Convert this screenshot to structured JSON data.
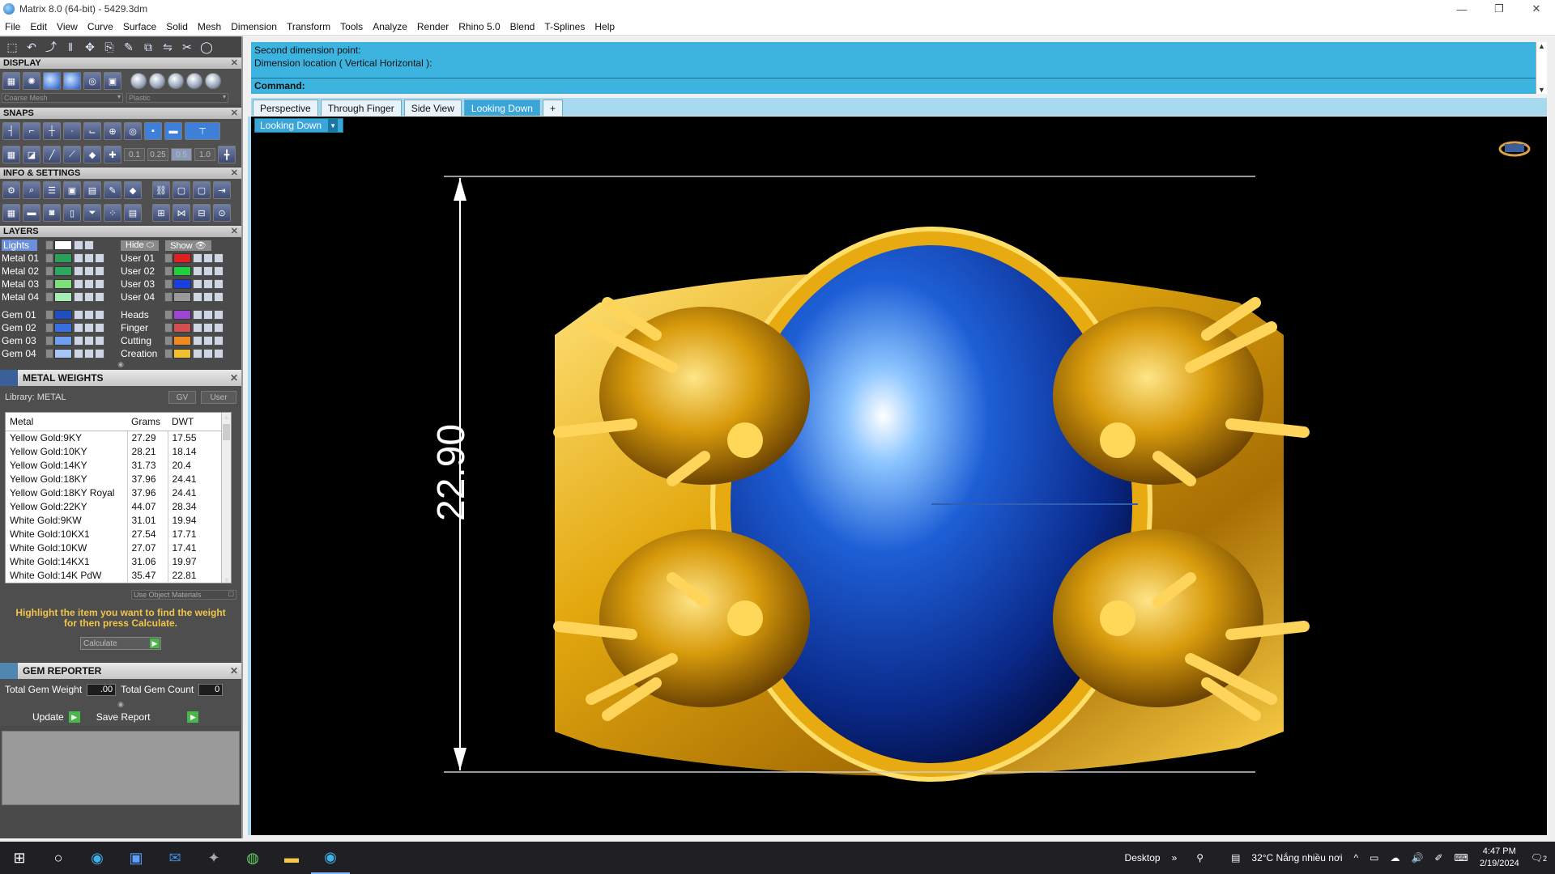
{
  "window": {
    "title": "Matrix 8.0 (64-bit) - 5429.3dm",
    "controls": [
      "—",
      "❐",
      "✕"
    ]
  },
  "menu": [
    "File",
    "Edit",
    "View",
    "Curve",
    "Surface",
    "Solid",
    "Mesh",
    "Dimension",
    "Transform",
    "Tools",
    "Analyze",
    "Render",
    "Rhino 5.0",
    "Blend",
    "T-Splines",
    "Help"
  ],
  "sections": {
    "display": "DISPLAY",
    "snaps": "SNAPS",
    "info": "INFO & SETTINGS",
    "layers": "LAYERS"
  },
  "display": {
    "mesh_select": "Coarse Mesh",
    "material_select": "Plastic"
  },
  "snaps": {
    "values": [
      "0.1",
      "0.25",
      "0.5",
      "1.0"
    ]
  },
  "layers": {
    "lights_label": "Lights",
    "hide_label": "Hide",
    "show_label": "Show",
    "left": [
      {
        "name": "Metal 01",
        "color": "#2aa05a"
      },
      {
        "name": "Metal 02",
        "color": "#2ea85f"
      },
      {
        "name": "Metal 03",
        "color": "#7de07a"
      },
      {
        "name": "Metal 04",
        "color": "#a8ecb5"
      },
      {
        "name": "Gem 01",
        "color": "#1f4fbf"
      },
      {
        "name": "Gem 02",
        "color": "#3a6fe0"
      },
      {
        "name": "Gem 03",
        "color": "#6f9ff0"
      },
      {
        "name": "Gem 04",
        "color": "#a6c6f5"
      }
    ],
    "right": [
      {
        "name": "User 01",
        "color": "#e02020"
      },
      {
        "name": "User 02",
        "color": "#20d040"
      },
      {
        "name": "User 03",
        "color": "#1a3fe0"
      },
      {
        "name": "User 04",
        "color": "#9a9a9a"
      },
      {
        "name": "Heads",
        "color": "#9b45d0"
      },
      {
        "name": "Finger",
        "color": "#d45050"
      },
      {
        "name": "Cutting",
        "color": "#f08a20"
      },
      {
        "name": "Creation",
        "color": "#f0c030"
      }
    ]
  },
  "metal_weights": {
    "title": "METAL WEIGHTS",
    "library": "Library: METAL",
    "gv_label": "GV",
    "user_label": "User",
    "headers": [
      "Metal",
      "Grams",
      "DWT"
    ],
    "rows": [
      [
        "Yellow Gold:9KY",
        "27.29",
        "17.55"
      ],
      [
        "Yellow Gold:10KY",
        "28.21",
        "18.14"
      ],
      [
        "Yellow Gold:14KY",
        "31.73",
        "20.4"
      ],
      [
        "Yellow Gold:18KY",
        "37.96",
        "24.41"
      ],
      [
        "Yellow Gold:18KY Royal",
        "37.96",
        "24.41"
      ],
      [
        "Yellow Gold:22KY",
        "44.07",
        "28.34"
      ],
      [
        "White Gold:9KW",
        "31.01",
        "19.94"
      ],
      [
        "White Gold:10KX1",
        "27.54",
        "17.71"
      ],
      [
        "White Gold:10KW",
        "27.07",
        "17.41"
      ],
      [
        "White Gold:14KX1",
        "31.06",
        "19.97"
      ],
      [
        "White Gold:14K PdW",
        "35.47",
        "22.81"
      ]
    ],
    "use_object_materials": "Use Object Materials",
    "hint": "Highlight the item you want to find the weight for then press Calculate.",
    "calculate": "Calculate"
  },
  "gem_reporter": {
    "title": "GEM REPORTER",
    "total_weight_label": "Total Gem Weight",
    "total_weight_value": ".00",
    "total_count_label": "Total Gem Count",
    "total_count_value": "0",
    "update_label": "Update",
    "save_label": "Save Report"
  },
  "command": {
    "line1": "Second dimension point:",
    "line2": "Dimension location ( Vertical  Horizontal ):",
    "prompt": "Command:"
  },
  "tabs": [
    "Perspective",
    "Through Finger",
    "Side View",
    "Looking Down",
    "+"
  ],
  "active_tab": "Looking Down",
  "viewport": {
    "label": "Looking Down",
    "dimension": "22.90"
  },
  "taskbar": {
    "desktop_label": "Desktop",
    "weather": "32°C  Nắng nhiều nơi",
    "time": "4:47 PM",
    "date": "2/19/2024",
    "notifications": "2"
  }
}
